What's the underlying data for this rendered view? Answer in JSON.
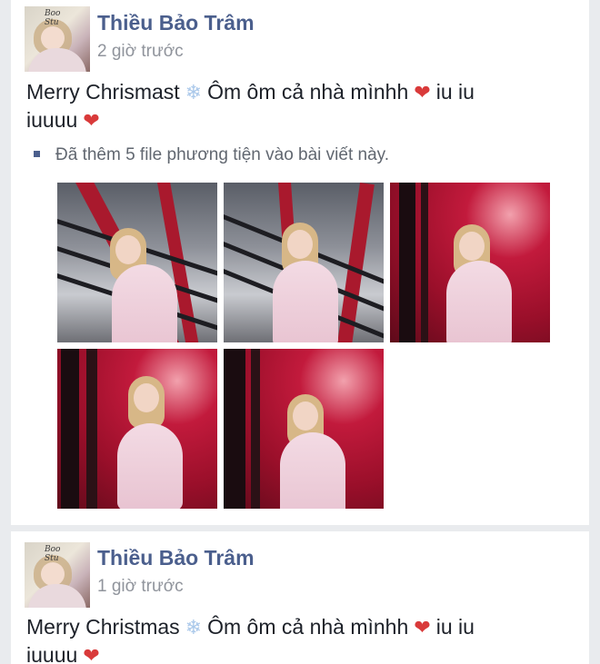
{
  "posts": [
    {
      "author": "Thiều Bảo Trâm",
      "time": "2 giờ trước",
      "text_line1_a": "Merry Chrismast",
      "text_line1_b": "Ôm ôm cả nhà mìnhh",
      "text_line1_c": "iu iu",
      "text_line2": "iuuuu",
      "added_media": "Đã thêm 5 file phương tiện vào bài viết này.",
      "photo_count": 5
    },
    {
      "author": "Thiều Bảo Trâm",
      "time": "1 giờ trước",
      "text_line1_a": "Merry Christmas",
      "text_line1_b": "Ôm ôm cả nhà mìnhh",
      "text_line1_c": "iu iu",
      "text_line2": "iuuuu"
    }
  ],
  "icons": {
    "snowflake": "snowflake-icon",
    "heart": "heart-icon",
    "bullet": "square-bullet-icon"
  },
  "colors": {
    "author_name": "#4b5f8d",
    "timestamp": "#90949c",
    "heart": "#d93a3a",
    "snowflake": "#aac8ea"
  }
}
